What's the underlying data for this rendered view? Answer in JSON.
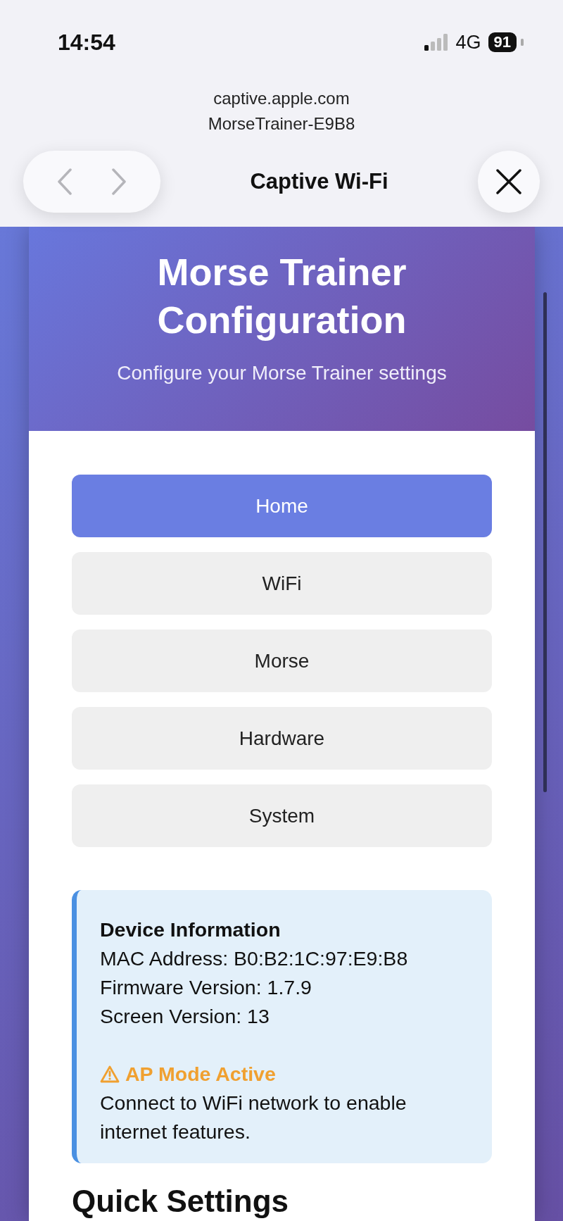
{
  "status_bar": {
    "time": "14:54",
    "network": "4G",
    "battery": "91"
  },
  "browser": {
    "host": "captive.apple.com",
    "network_name": "MorseTrainer-E9B8",
    "title": "Captive Wi-Fi"
  },
  "header": {
    "title": "Morse Trainer Configuration",
    "subtitle": "Configure your Morse Trainer settings"
  },
  "nav": [
    {
      "label": "Home",
      "selected": true
    },
    {
      "label": "WiFi",
      "selected": false
    },
    {
      "label": "Morse",
      "selected": false
    },
    {
      "label": "Hardware",
      "selected": false
    },
    {
      "label": "System",
      "selected": false
    }
  ],
  "device_info": {
    "title": "Device Information",
    "lines": [
      "MAC Address: B0:B2:1C:97:E9:B8",
      "Firmware Version: 1.7.9",
      "Screen Version: 13"
    ],
    "warning": {
      "title": "AP Mode Active",
      "text": "Connect to WiFi network to enable internet features."
    }
  },
  "section_heading": "Quick Settings"
}
